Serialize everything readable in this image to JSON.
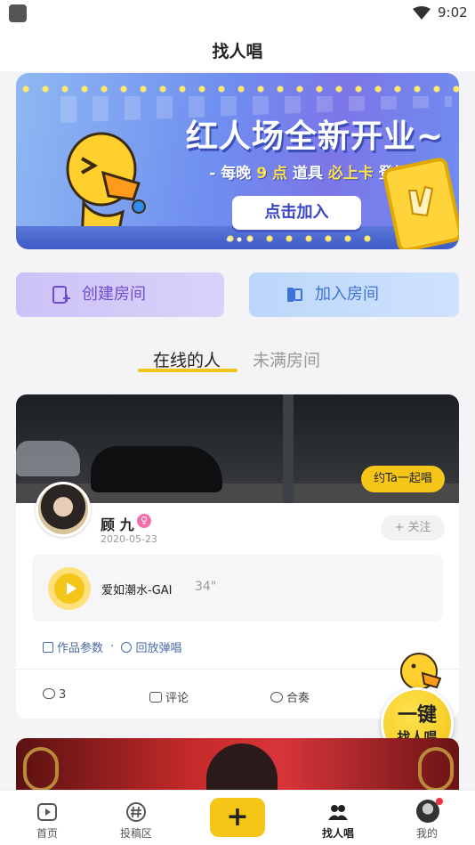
{
  "status_bar": {
    "time": "9:02",
    "wifi_icon": "wifi-icon",
    "app_icon": "app-notification-icon"
  },
  "header": {
    "title": "找人唱"
  },
  "banner": {
    "headline": "红人场全新开业~",
    "subtitle_parts": [
      "- 每晚 ",
      "9 点",
      " 道具 ",
      "必上卡",
      " 登场 -"
    ],
    "button_label": "点击加入"
  },
  "actions": {
    "create_label": "创建房间",
    "join_label": "加入房间"
  },
  "tabs": [
    {
      "label": "在线的人",
      "active": true
    },
    {
      "label": "未满房间",
      "active": false
    }
  ],
  "card": {
    "invite_label": "约Ta一起唱",
    "user_name": "顾 九",
    "gender_icon": "female-icon",
    "gender_symbol": "♀",
    "date": "2020-05-23",
    "follow_label": "+ 关注",
    "song_title": "爱如潮水-GAI",
    "song_duration": "34\"",
    "meta_left": "作品参数",
    "meta_separator": "·",
    "meta_right": "回放弹唱",
    "like_count": "3",
    "comment_label": "评论",
    "duet_label": "合奏"
  },
  "float_button": {
    "line1": "一键",
    "line2": "找人唱"
  },
  "navbar": [
    {
      "label": "首页",
      "icon": "play-icon",
      "active": false
    },
    {
      "label": "投稿区",
      "icon": "hashtag-icon",
      "active": false
    },
    {
      "label": "+",
      "icon": "plus-icon",
      "active": false
    },
    {
      "label": "找人唱",
      "icon": "people-icon",
      "active": true
    },
    {
      "label": "我的",
      "icon": "avatar-icon",
      "active": false
    }
  ],
  "colors": {
    "accent": "#f5c518",
    "create": "#6b4fcf",
    "join": "#3c72d9",
    "link": "#4b6aa8"
  }
}
